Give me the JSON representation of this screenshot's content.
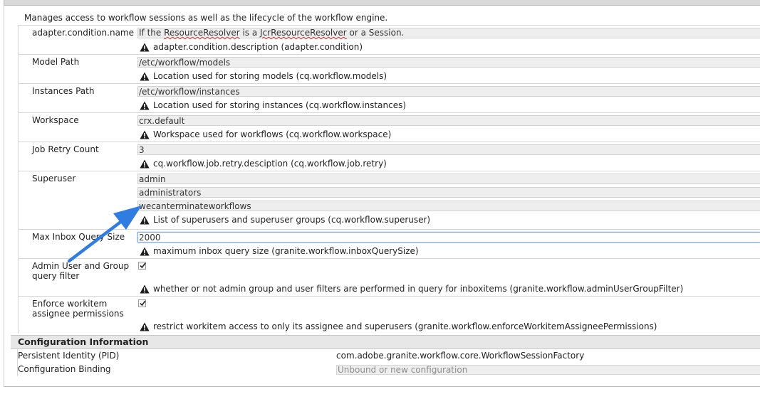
{
  "description": "Manages access to workflow sessions as well as the lifecycle of the workflow engine.",
  "properties": [
    {
      "label": "adapter.condition.name",
      "values": [
        "If the ResourceResolver is a JcrResourceResolver or a Session."
      ],
      "help": "adapter.condition.description (adapter.condition)"
    },
    {
      "label": "Model Path",
      "values": [
        "/etc/workflow/models"
      ],
      "help": "Location used for storing models (cq.workflow.models)"
    },
    {
      "label": "Instances Path",
      "values": [
        "/etc/workflow/instances"
      ],
      "help": "Location used for storing instances (cq.workflow.instances)"
    },
    {
      "label": "Workspace",
      "values": [
        "crx.default"
      ],
      "help": "Workspace used for workflows (cq.workflow.workspace)"
    },
    {
      "label": "Job Retry Count",
      "values": [
        "3"
      ],
      "help": "cq.workflow.job.retry.desciption (cq.workflow.job.retry)"
    },
    {
      "label": "Superuser",
      "values": [
        "admin",
        "administrators",
        "wecanterminateworkflows"
      ],
      "help": "List of superusers and superuser groups (cq.workflow.superuser)"
    },
    {
      "label": "Max Inbox Query Size",
      "values": [
        "2000"
      ],
      "help": "maximum inbox query size (granite.workflow.inboxQuerySize)"
    },
    {
      "label": "Admin User and Group query filter",
      "checked": true,
      "help": "whether or not admin group and user filters are performed in query for inboxitems (granite.workflow.adminUserGroupFilter)"
    },
    {
      "label": "Enforce workitem assignee permissions",
      "checked": true,
      "help": "restrict workitem access to only its assignee and superusers (granite.workflow.enforceWorkitemAssigneePermissions)"
    }
  ],
  "configuration": {
    "title": "Configuration Information",
    "pid_label": "Persistent Identity (PID)",
    "pid_value": "com.adobe.granite.workflow.core.WorkflowSessionFactory",
    "binding_label": "Configuration Binding",
    "binding_value": "Unbound or new configuration"
  },
  "icons": {
    "help": "warning-triangle-icon",
    "annotation": "annotation-arrow-icon",
    "check": "checkmark-icon"
  },
  "colors": {
    "arrow": "#2f7de1",
    "focus_border": "#7aa7d8",
    "spellcheck": "#d93030"
  }
}
